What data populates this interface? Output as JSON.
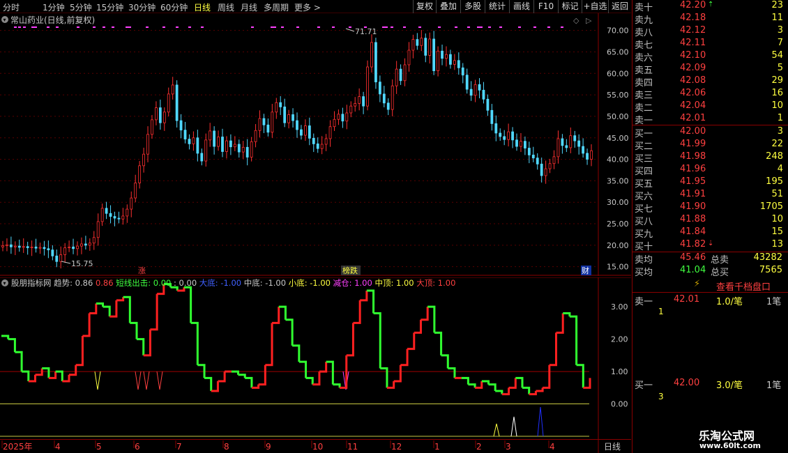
{
  "toolbar": {
    "tabs": [
      "分时",
      "1分钟",
      "5分钟",
      "15分钟",
      "30分钟",
      "60分钟",
      "日线",
      "周线",
      "月线",
      "多周期",
      "更多 >"
    ],
    "active_tab": "日线",
    "buttons": [
      "复权",
      "叠加",
      "多股",
      "统计",
      "画线",
      "F10",
      "标记",
      "+自选",
      "返回"
    ]
  },
  "main_chart": {
    "title": "常山药业(日线,前复权)",
    "high_label": "71.71",
    "low_label": "15.75",
    "y_ticks": [
      "70.00",
      "65.00",
      "60.00",
      "55.00",
      "50.00",
      "45.00",
      "40.00",
      "35.00",
      "30.00",
      "25.00",
      "20.00",
      "15.00"
    ],
    "markers": {
      "zhang": "涨",
      "bang_die": "榜跌",
      "cai": "财"
    }
  },
  "indicator": {
    "name": "股朋指标网",
    "items": [
      {
        "label": "趋势:",
        "value": "0.86",
        "color": "#c8c8c8"
      },
      {
        "label": "",
        "value": "0.86",
        "color": "#ff4040"
      },
      {
        "label": "短线出击:",
        "value": "0.00",
        "color": "#40ff40"
      },
      {
        "label": ":",
        "value": "0.00",
        "color": "#c8c8c8"
      },
      {
        "label": "大底:",
        "value": "-1.00",
        "color": "#4060ff"
      },
      {
        "label": "中底:",
        "value": "-1.00",
        "color": "#c8c8c8"
      },
      {
        "label": "小底:",
        "value": "-1.00",
        "color": "#ffff40"
      },
      {
        "label": "减仓:",
        "value": "1.00",
        "color": "#ff40ff"
      },
      {
        "label": "中顶:",
        "value": "1.00",
        "color": "#ffff40"
      },
      {
        "label": "大顶:",
        "value": "1.00",
        "color": "#ff4040"
      }
    ],
    "y_ticks": [
      "3.00",
      "2.00",
      "1.00",
      "0.00"
    ]
  },
  "x_axis": {
    "labels": [
      "2025年",
      "4",
      "5",
      "6",
      "7",
      "8",
      "9",
      "10",
      "11",
      "12",
      "1",
      "2",
      "3",
      "4"
    ],
    "period": "日线"
  },
  "order_book": {
    "sells": [
      {
        "label": "卖十",
        "price": "42.20",
        "vol": "23",
        "mark": "⇡"
      },
      {
        "label": "卖九",
        "price": "42.18",
        "vol": "11",
        "mark": ""
      },
      {
        "label": "卖八",
        "price": "42.12",
        "vol": "3",
        "mark": ""
      },
      {
        "label": "卖七",
        "price": "42.11",
        "vol": "7",
        "mark": ""
      },
      {
        "label": "卖六",
        "price": "42.10",
        "vol": "54",
        "mark": ""
      },
      {
        "label": "卖五",
        "price": "42.09",
        "vol": "5",
        "mark": ""
      },
      {
        "label": "卖四",
        "price": "42.08",
        "vol": "29",
        "mark": ""
      },
      {
        "label": "卖三",
        "price": "42.06",
        "vol": "16",
        "mark": ""
      },
      {
        "label": "卖二",
        "price": "42.04",
        "vol": "10",
        "mark": ""
      },
      {
        "label": "卖一",
        "price": "42.01",
        "vol": "1",
        "mark": ""
      }
    ],
    "buys": [
      {
        "label": "买一",
        "price": "42.00",
        "vol": "3",
        "mark": ""
      },
      {
        "label": "买二",
        "price": "41.99",
        "vol": "22",
        "mark": ""
      },
      {
        "label": "买三",
        "price": "41.98",
        "vol": "248",
        "mark": ""
      },
      {
        "label": "买四",
        "price": "41.96",
        "vol": "4",
        "mark": ""
      },
      {
        "label": "买五",
        "price": "41.95",
        "vol": "195",
        "mark": ""
      },
      {
        "label": "买六",
        "price": "41.91",
        "vol": "51",
        "mark": ""
      },
      {
        "label": "买七",
        "price": "41.90",
        "vol": "1705",
        "mark": ""
      },
      {
        "label": "买八",
        "price": "41.88",
        "vol": "10",
        "mark": ""
      },
      {
        "label": "买九",
        "price": "41.84",
        "vol": "15",
        "mark": ""
      },
      {
        "label": "买十",
        "price": "41.82",
        "vol": "13",
        "mark": "⇣"
      }
    ],
    "summary": {
      "sell_avg_label": "卖均",
      "sell_avg": "45.46",
      "total_sell_label": "总卖",
      "total_sell": "43282",
      "buy_avg_label": "买均",
      "buy_avg": "41.04",
      "total_buy_label": "总买",
      "total_buy": "7565"
    }
  },
  "level2": {
    "link": "查看千档盘口",
    "sell_row": {
      "label": "卖一",
      "price": "42.01",
      "per": "1.0/笔",
      "count": "1笔",
      "sub": "1"
    },
    "buy_row": {
      "label": "买一",
      "price": "42.00",
      "per": "3.0/笔",
      "count": "1笔",
      "sub": "3"
    }
  },
  "watermark": {
    "title": "乐淘公式网",
    "url": "www.60lt.com"
  },
  "chart_data": {
    "type": "candlestick",
    "title": "常山药业(日线,前复权)",
    "ylim": [
      13,
      74
    ],
    "y_ticks": [
      15,
      20,
      25,
      30,
      35,
      40,
      45,
      50,
      55,
      60,
      65,
      70
    ],
    "series_close": [
      19.9,
      20.1,
      19.6,
      19.8,
      19.5,
      19.7,
      19.4,
      19.6,
      19.3,
      19.5,
      19.2,
      18.9,
      17.5,
      16.2,
      17.8,
      19.4,
      19.6,
      19.2,
      19.8,
      20.3,
      20.0,
      20.5,
      21.8,
      25.5,
      28.6,
      27.4,
      26.7,
      26.3,
      26.1,
      26.8,
      28.4,
      31.0,
      34.5,
      38.5,
      41.2,
      45.8,
      49.2,
      52.0,
      48.5,
      51.0,
      55.2,
      57.3,
      49.0,
      46.8,
      44.7,
      43.6,
      45.0,
      41.4,
      39.6,
      44.5,
      46.6,
      43.0,
      45.2,
      41.8,
      44.3,
      42.9,
      43.5,
      41.7,
      42.8,
      40.5,
      44.1,
      46.7,
      49.5,
      48.0,
      46.3,
      51.0,
      53.2,
      52.2,
      48.5,
      50.4,
      49.0,
      46.9,
      45.6,
      47.8,
      44.9,
      43.6,
      42.5,
      43.5,
      44.8,
      47.6,
      49.3,
      50.5,
      48.9,
      50.8,
      52.4,
      53.0,
      54.6,
      52.4,
      61.5,
      67.2,
      58.0,
      55.2,
      53.1,
      51.6,
      57.1,
      61.0,
      58.3,
      62.0,
      65.4,
      67.9,
      66.5,
      68.2,
      64.2,
      68.0,
      60.6,
      65.2,
      63.5,
      64.4,
      62.1,
      63.0,
      61.3,
      59.6,
      56.3,
      54.9,
      57.4,
      56.1,
      54.0,
      51.4,
      48.3,
      46.1,
      45.3,
      44.6,
      46.4,
      44.5,
      43.0,
      44.2,
      42.6,
      41.0,
      40.3,
      38.9,
      36.2,
      37.8,
      39.0,
      40.6,
      44.8,
      43.2,
      42.7,
      45.5,
      44.3,
      43.0,
      41.4,
      40.0,
      42.0
    ],
    "indicator": {
      "name": "股朋指标网",
      "ylim": [
        -1,
        3.8
      ],
      "trend_close": [
        2.1,
        2.0,
        1.6,
        1.0,
        0.7,
        0.9,
        1.1,
        0.8,
        1.0,
        0.7,
        0.9,
        1.2,
        2.1,
        2.8,
        3.1,
        3.0,
        2.7,
        3.2,
        3.3,
        2.5,
        2.0,
        1.5,
        2.3,
        3.4,
        3.7,
        3.6,
        3.5,
        3.6,
        2.5,
        1.2,
        0.8,
        0.4,
        0.7,
        1.0,
        1.0,
        0.9,
        0.8,
        0.5,
        0.6,
        1.2,
        2.5,
        3.0,
        2.6,
        1.8,
        1.3,
        0.8,
        0.6,
        1.0,
        1.3,
        0.6,
        0.5,
        1.5,
        2.5,
        3.2,
        3.5,
        2.8,
        1.1,
        0.5,
        0.7,
        1.2,
        1.7,
        2.2,
        2.6,
        3.0,
        2.2,
        1.5,
        1.1,
        0.8,
        0.8,
        0.6,
        0.5,
        0.7,
        0.6,
        0.4,
        0.3,
        0.5,
        0.8,
        0.5,
        0.3,
        0.4,
        0.5,
        1.2,
        2.2,
        2.8,
        2.7,
        1.2,
        0.5,
        0.8
      ],
      "reference_lines": [
        1.0,
        0.0,
        -1.0
      ]
    }
  }
}
